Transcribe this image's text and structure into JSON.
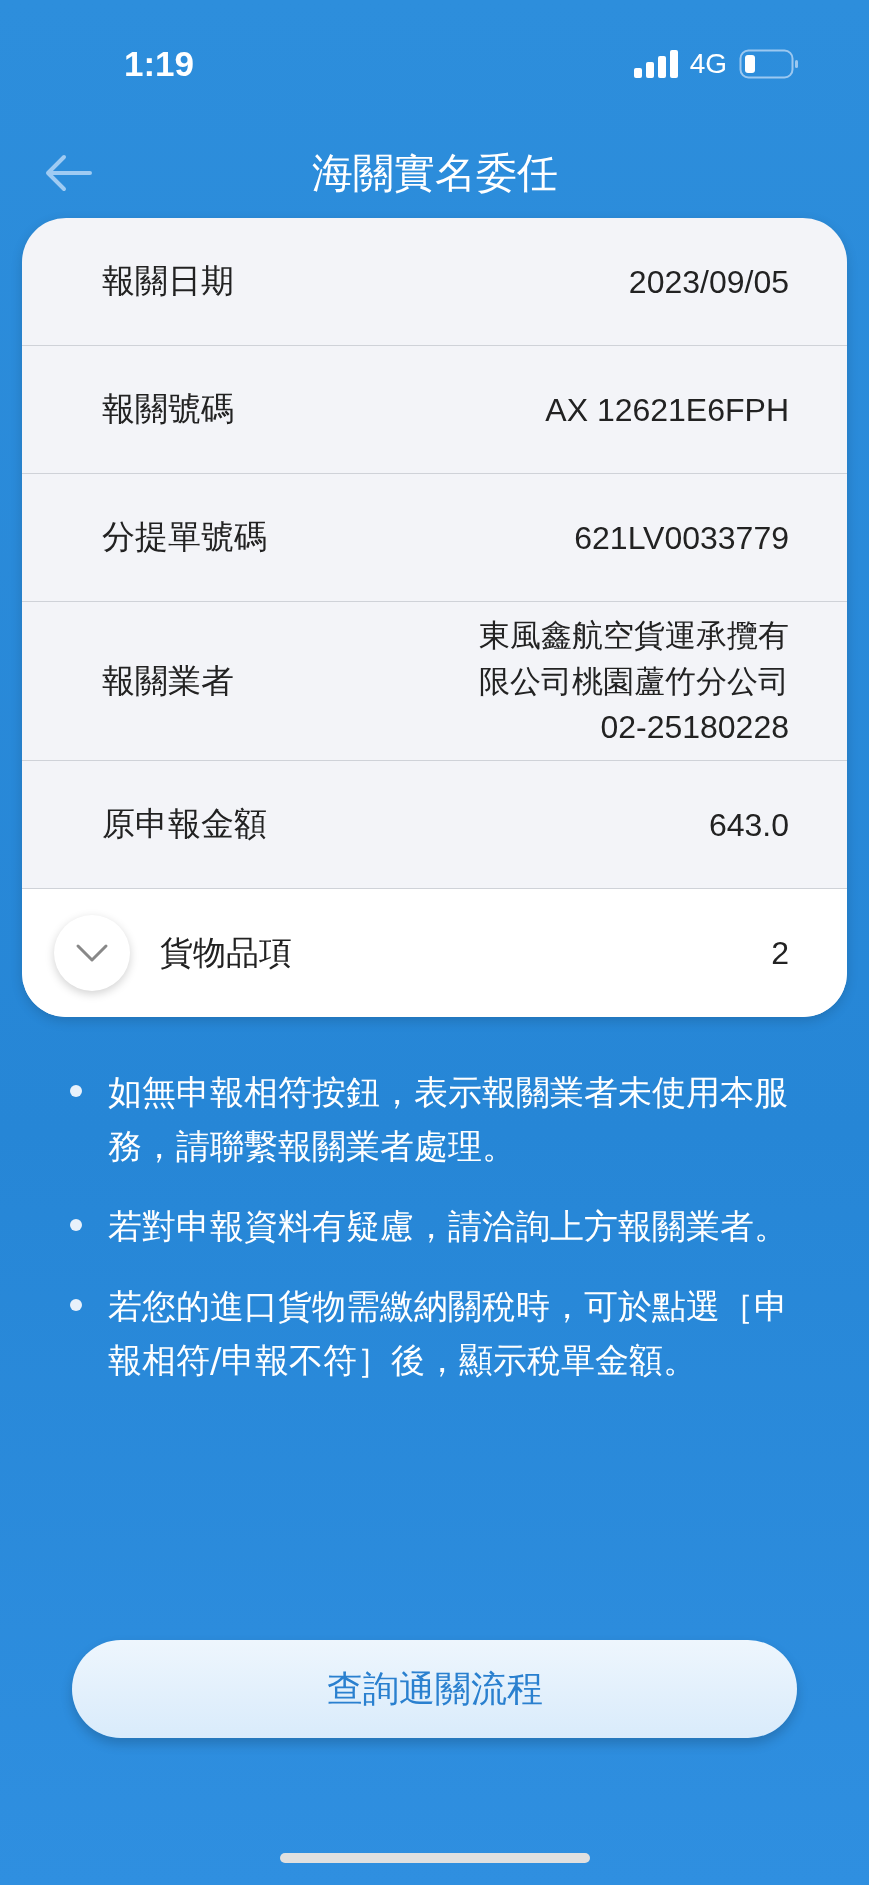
{
  "status_bar": {
    "time": "1:19",
    "network": "4G"
  },
  "header": {
    "title": "海關實名委任"
  },
  "details": [
    {
      "label": "報關日期",
      "value": "2023/09/05"
    },
    {
      "label": "報關號碼",
      "value": "AX  12621E6FPH"
    },
    {
      "label": "分提單號碼",
      "value": "621LV0033779"
    },
    {
      "label": "報關業者",
      "value": "東風鑫航空貨運承攬有限公司桃園蘆竹分公司",
      "phone": "02-25180228"
    },
    {
      "label": "原申報金額",
      "value": "643.0"
    }
  ],
  "items_row": {
    "label": "貨物品項",
    "value": "2",
    "expanded": false
  },
  "notes": [
    "如無申報相符按鈕，表示報關業者未使用本服務，請聯繫報關業者處理。",
    "若對申報資料有疑慮，請洽詢上方報關業者。",
    "若您的進口貨物需繳納關稅時，可於點選［申報相符/申報不符］後，顯示稅單金額。"
  ],
  "primary_button": {
    "label": "查詢通關流程"
  }
}
